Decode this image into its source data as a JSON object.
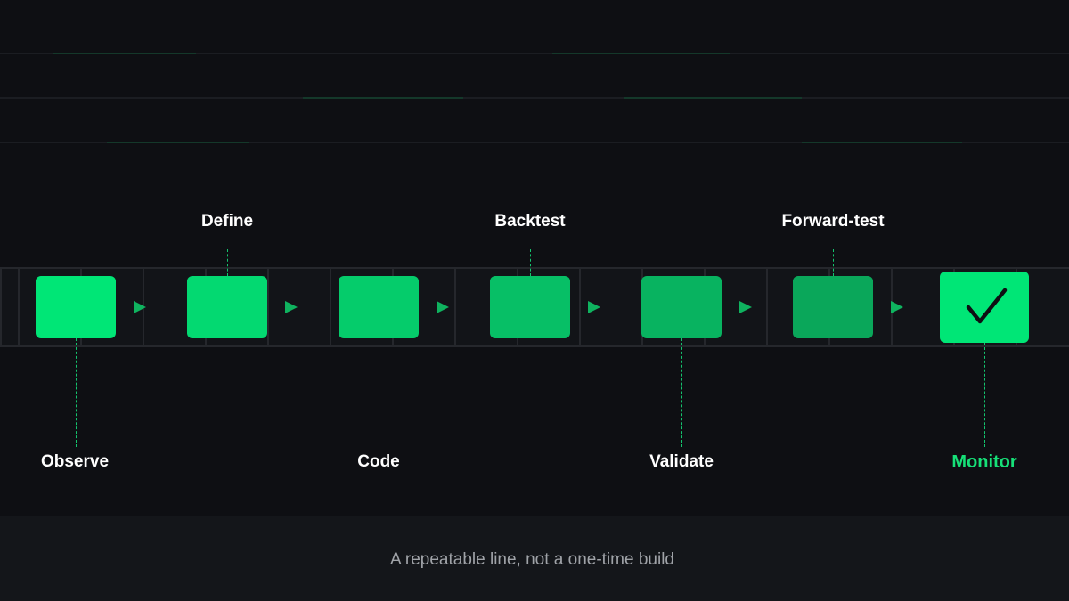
{
  "stages": [
    {
      "label": "Observe",
      "color": "#00e676"
    },
    {
      "label": "Define",
      "color": "#03d971"
    },
    {
      "label": "Code",
      "color": "#05cc6b"
    },
    {
      "label": "Backtest",
      "color": "#07bf66"
    },
    {
      "label": "Validate",
      "color": "#08b360"
    },
    {
      "label": "Forward-test",
      "color": "#0aa75a"
    },
    {
      "label": "Monitor",
      "color": "#00e676",
      "active_label_color": "#16e078"
    }
  ],
  "caption": "A repeatable line, not a one-time build",
  "colors": {
    "background": "#0e0f13",
    "belt": "#121418",
    "arrow": "#0fb35f",
    "connector": "#14c46e",
    "footer": "#14161a",
    "caption": "#a0a3a8"
  },
  "icons": {
    "final": "checkmark-icon",
    "step": "arrow-right-icon"
  }
}
